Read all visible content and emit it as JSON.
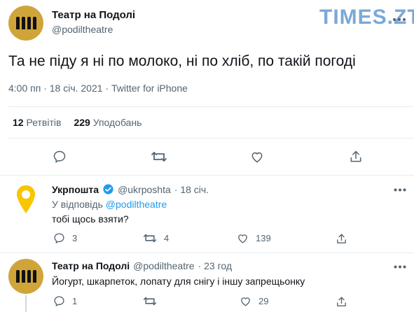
{
  "watermark": {
    "brand": "TIMES.ZT",
    "color": "#7aa9d6"
  },
  "main_tweet": {
    "author_name": "Театр на Подолі",
    "author_handle": "@podiltheatre",
    "text": "Та не піду я ні по молоко, ні по хліб, по такій погоді",
    "timestamp": "4:00 пп · 18 січ. 2021 · Twitter for iPhone",
    "retweets_count": "12",
    "retweets_label": "Ретвітів",
    "likes_count": "229",
    "likes_label": "Уподобань",
    "actions": [
      "reply-icon",
      "retweet-icon",
      "like-icon",
      "share-icon"
    ]
  },
  "replies": [
    {
      "author_name": "Укрпошта",
      "author_handle": "@ukrposhta",
      "time": "· 18 січ.",
      "reply_prefix": "У відповідь",
      "reply_to": "@podiltheatre",
      "text": "тобі щось взяти?",
      "reply_count": "3",
      "retweet_count": "4",
      "like_count": "139",
      "verified": true
    },
    {
      "author_name": "Театр на Подолі",
      "author_handle": "@podiltheatre",
      "time": "· 23 год",
      "text": "Йогурт, шкарпеток, лопату для снігу і іншу запрещьонку",
      "reply_count": "1",
      "retweet_count": "",
      "like_count": "29"
    }
  ],
  "colors": {
    "brand_yellow": "#cfa53a",
    "ukrposhta_yellow": "#f7c600",
    "verified_blue": "#1d9bf0",
    "text_gray": "#536471"
  }
}
